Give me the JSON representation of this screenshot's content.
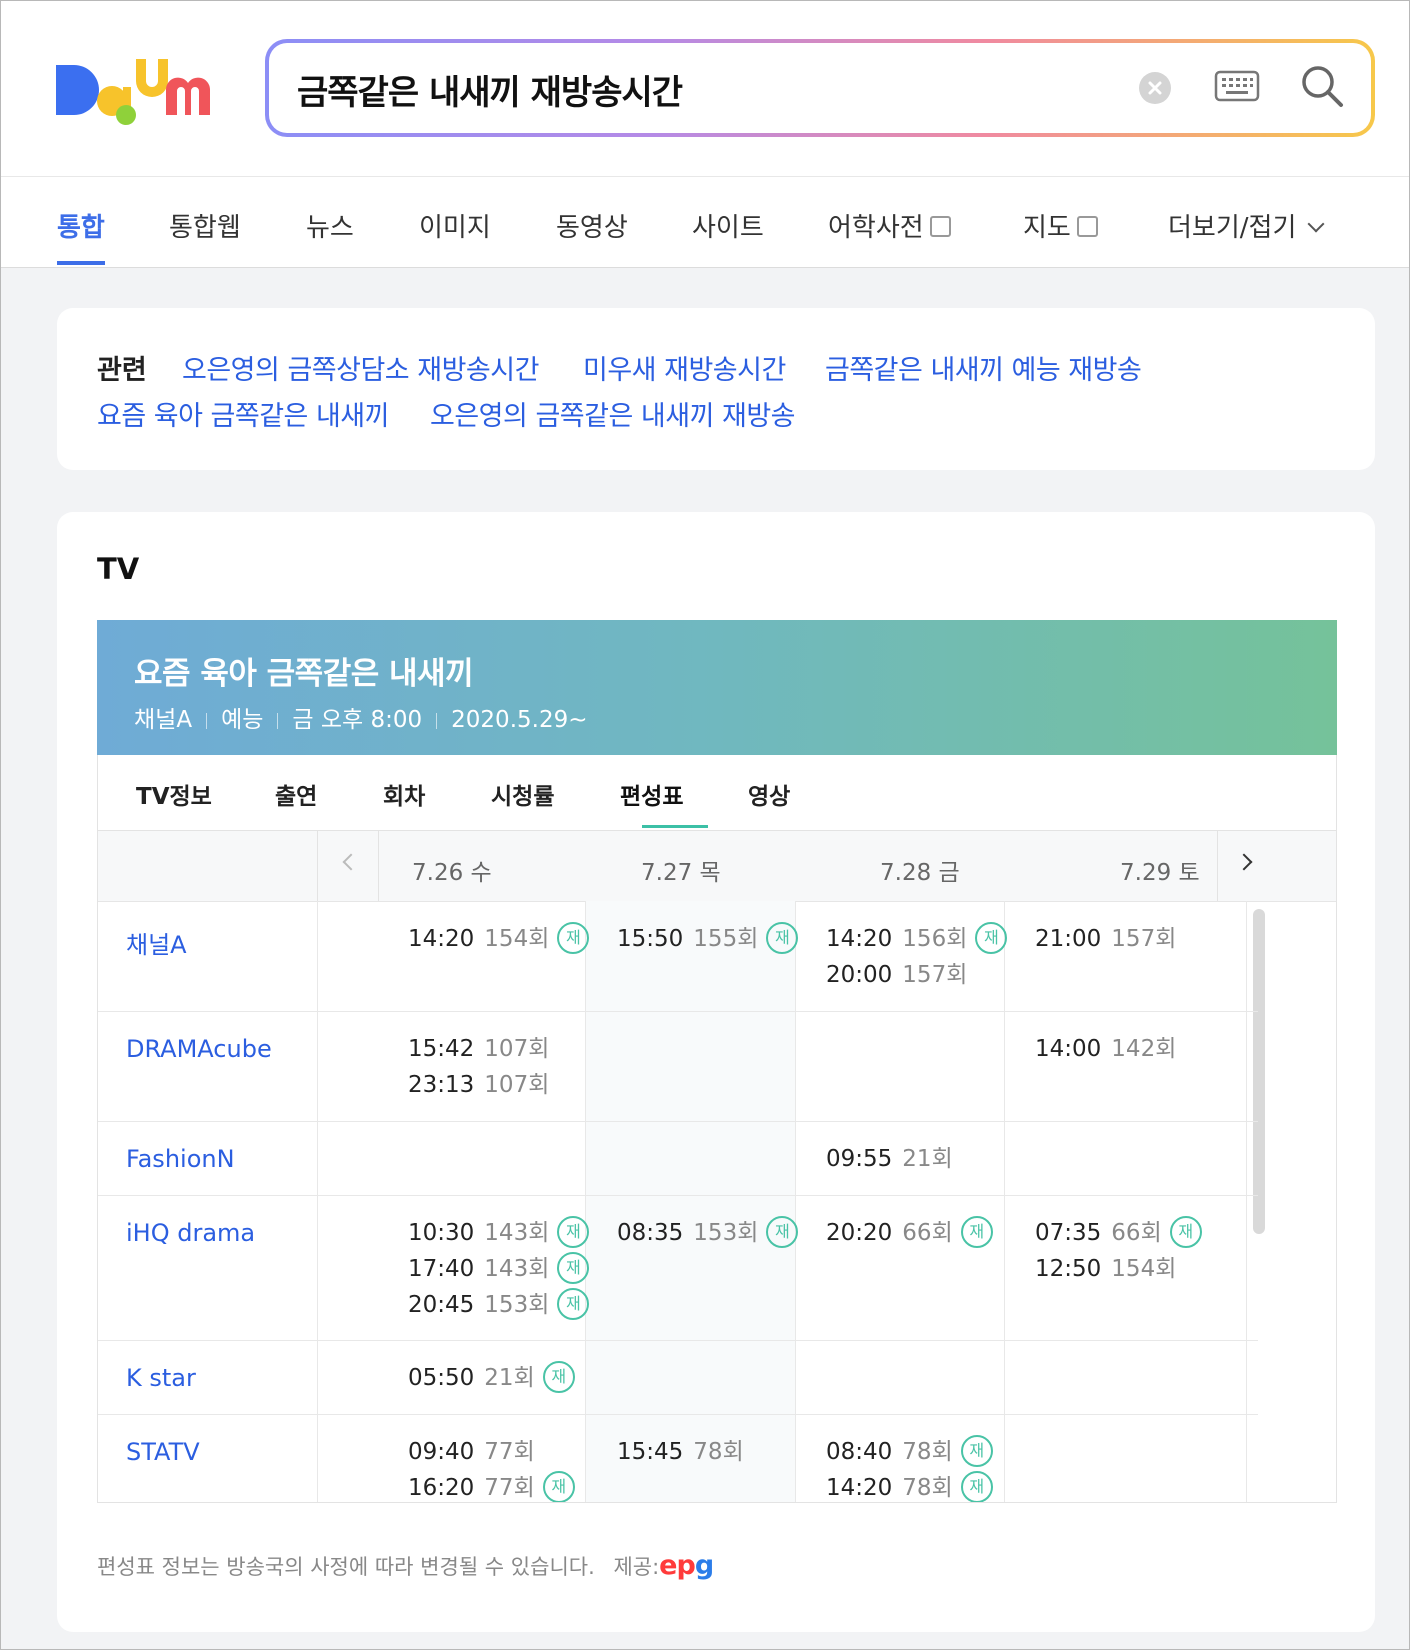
{
  "search": {
    "query": "금쪽같은 내새끼 재방송시간"
  },
  "nav_tabs": [
    "통합",
    "통합웹",
    "뉴스",
    "이미지",
    "동영상",
    "사이트",
    "어학사전",
    "지도",
    "더보기/접기"
  ],
  "related": {
    "label": "관련",
    "links": [
      "오은영의 금쪽상담소 재방송시간",
      "미우새 재방송시간",
      "금쪽같은 내새끼 예능 재방송",
      "요즘 육아 금쪽같은 내새끼",
      "오은영의 금쪽같은 내새끼 재방송"
    ]
  },
  "tv": {
    "section_title": "TV",
    "show_title": "요즘 육아 금쪽같은 내새끼",
    "meta": [
      "채널A",
      "예능",
      "금 오후 8:00",
      "2020.5.29~"
    ],
    "subtabs": [
      "TV정보",
      "출연",
      "회차",
      "시청률",
      "편성표",
      "영상"
    ],
    "active_subtab": "편성표",
    "dates": [
      "7.26 수",
      "7.27 목",
      "7.28 금",
      "7.29 토"
    ],
    "rerun_label": "재",
    "channels": [
      {
        "name": "채널A",
        "days": [
          [
            {
              "time": "14:20",
              "ep": "154회",
              "re": true
            }
          ],
          [
            {
              "time": "15:50",
              "ep": "155회",
              "re": true
            }
          ],
          [
            {
              "time": "14:20",
              "ep": "156회",
              "re": true
            },
            {
              "time": "20:00",
              "ep": "157회",
              "re": false
            }
          ],
          [
            {
              "time": "21:00",
              "ep": "157회",
              "re": false
            }
          ]
        ]
      },
      {
        "name": "DRAMAcube",
        "days": [
          [
            {
              "time": "15:42",
              "ep": "107회",
              "re": false
            },
            {
              "time": "23:13",
              "ep": "107회",
              "re": false
            }
          ],
          [],
          [],
          [
            {
              "time": "14:00",
              "ep": "142회",
              "re": false
            }
          ]
        ]
      },
      {
        "name": "FashionN",
        "days": [
          [],
          [],
          [
            {
              "time": "09:55",
              "ep": "21회",
              "re": false
            }
          ],
          []
        ]
      },
      {
        "name": "iHQ drama",
        "days": [
          [
            {
              "time": "10:30",
              "ep": "143회",
              "re": true
            },
            {
              "time": "17:40",
              "ep": "143회",
              "re": true
            },
            {
              "time": "20:45",
              "ep": "153회",
              "re": true
            }
          ],
          [
            {
              "time": "08:35",
              "ep": "153회",
              "re": true
            }
          ],
          [
            {
              "time": "20:20",
              "ep": "66회",
              "re": true
            }
          ],
          [
            {
              "time": "07:35",
              "ep": "66회",
              "re": true
            },
            {
              "time": "12:50",
              "ep": "154회",
              "re": false
            }
          ]
        ]
      },
      {
        "name": "K star",
        "days": [
          [
            {
              "time": "05:50",
              "ep": "21회",
              "re": true
            }
          ],
          [],
          [],
          []
        ]
      },
      {
        "name": "STATV",
        "days": [
          [
            {
              "time": "09:40",
              "ep": "77회",
              "re": false
            },
            {
              "time": "16:20",
              "ep": "77회",
              "re": true
            }
          ],
          [
            {
              "time": "15:45",
              "ep": "78회",
              "re": false
            }
          ],
          [
            {
              "time": "08:40",
              "ep": "78회",
              "re": true
            },
            {
              "time": "14:20",
              "ep": "78회",
              "re": true
            }
          ],
          []
        ]
      }
    ],
    "footnote": "편성표 정보는 방송국의 사정에 따라 변경될 수 있습니다.",
    "provider_label": "제공:",
    "provider_logo": "epg"
  }
}
